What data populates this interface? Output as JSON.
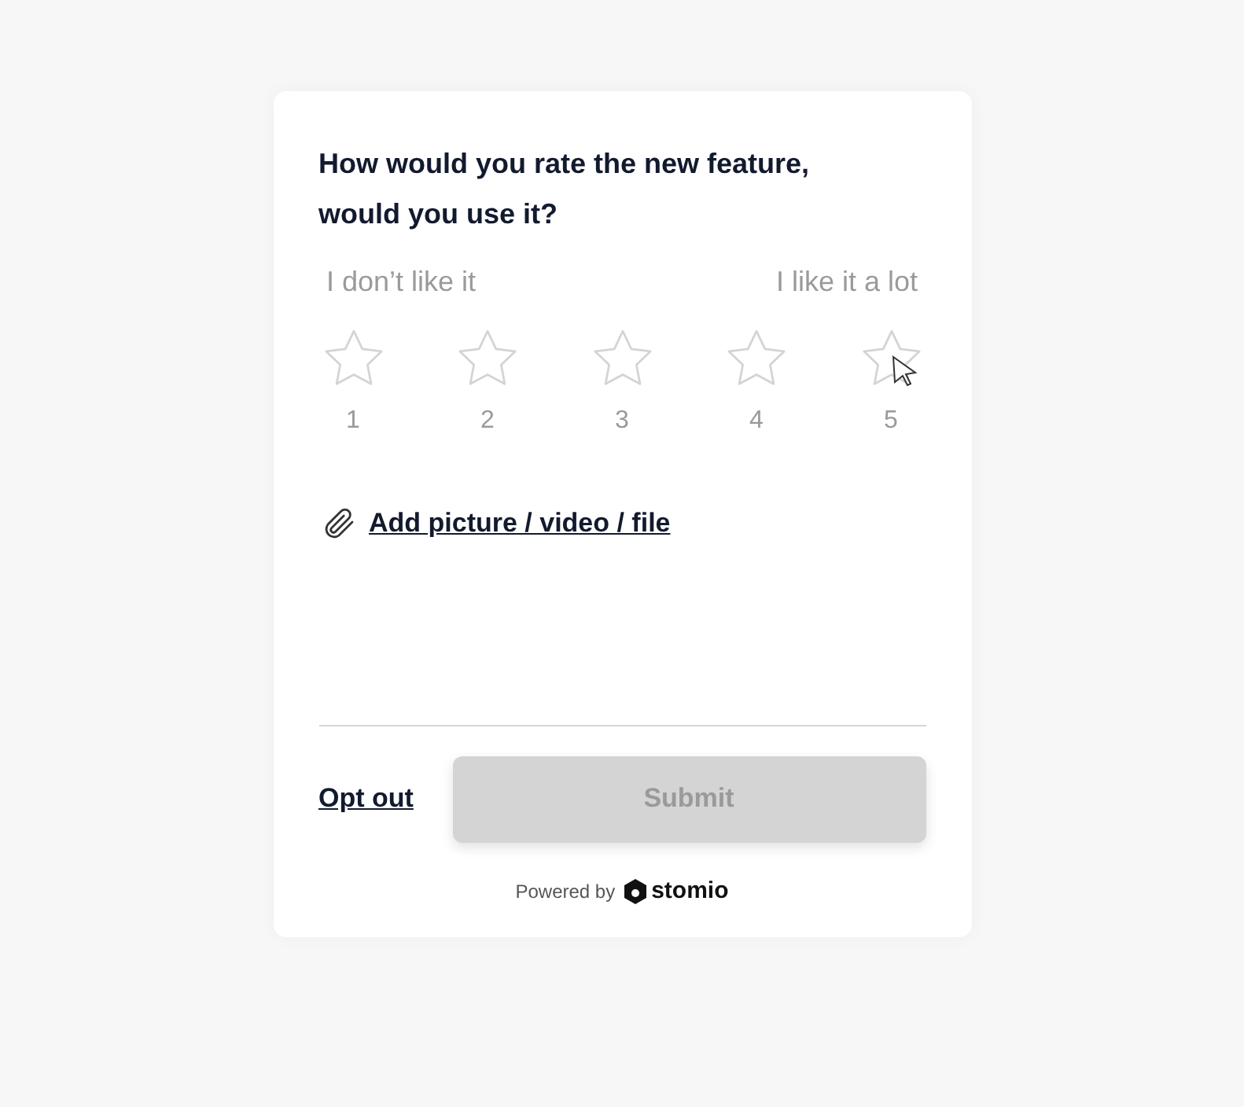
{
  "question": "How would you rate the new feature, would you use it?",
  "scale_labels": {
    "low": "I don’t like it",
    "high": "I like it a lot"
  },
  "rating": {
    "stars": 0,
    "numbers": [
      "1",
      "2",
      "3",
      "4",
      "5"
    ]
  },
  "attachment": {
    "label": "Add picture / video / file"
  },
  "footer": {
    "opt_out": "Opt out",
    "submit": {
      "label": "Submit",
      "disabled": true
    }
  },
  "powered_by": {
    "text": "Powered by",
    "brand": "stomio"
  }
}
